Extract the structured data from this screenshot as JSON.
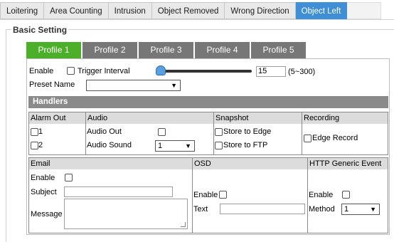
{
  "top_tabs": [
    "Loitering",
    "Area Counting",
    "Intrusion",
    "Object Removed",
    "Wrong Direction",
    "Object Left"
  ],
  "active_top_tab": "Object Left",
  "section_title": "Basic Setting",
  "profiles": [
    "Profile 1",
    "Profile 2",
    "Profile 3",
    "Profile 4",
    "Profile 5"
  ],
  "active_profile": "Profile 1",
  "settings": {
    "enable_label": "Enable",
    "trigger_interval_label": "Trigger Interval",
    "trigger_interval_value": "15",
    "trigger_interval_range": "(5~300)",
    "preset_name_label": "Preset Name",
    "preset_name_value": ""
  },
  "handlers": {
    "title": "Handlers",
    "alarm_out": {
      "header": "Alarm Out",
      "items": [
        "1",
        "2"
      ]
    },
    "audio": {
      "header": "Audio",
      "audio_out_label": "Audio Out",
      "audio_sound_label": "Audio Sound",
      "audio_sound_value": "1"
    },
    "snapshot": {
      "header": "Snapshot",
      "store_edge_label": "Store to Edge",
      "store_ftp_label": "Store to FTP"
    },
    "recording": {
      "header": "Recording",
      "edge_record_label": "Edge Record"
    },
    "email": {
      "header": "Email",
      "enable_label": "Enable",
      "subject_label": "Subject",
      "subject_value": "",
      "message_label": "Message",
      "message_value": ""
    },
    "osd": {
      "header": "OSD",
      "enable_label": "Enable",
      "text_label": "Text",
      "text_value": ""
    },
    "http": {
      "header": "HTTP Generic Event",
      "enable_label": "Enable",
      "method_label": "Method",
      "method_value": "1"
    }
  },
  "colors": {
    "active_tab": "#3f8fd6",
    "active_profile": "#4caf2a",
    "profile_tab": "#777777",
    "handlers_bar": "#8a8a8a"
  }
}
